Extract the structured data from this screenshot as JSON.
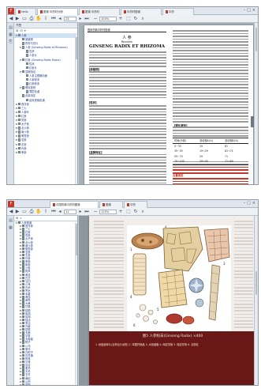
{
  "win1": {
    "tabs": [
      {
        "label": "Hello",
        "active": false
      },
      {
        "label": "图谱·中药材分册",
        "active": true
      },
      {
        "label": "图谱·中药材",
        "active": false
      },
      {
        "label": "中药材图谱",
        "active": false
      },
      {
        "label": "中药",
        "active": false
      }
    ],
    "page_field": "23",
    "zoom_field": "100%",
    "bookmarks_title": "书签",
    "bookmarks": [
      {
        "label": "人参",
        "level": 0,
        "expander": "minus"
      },
      {
        "label": "原植物",
        "level": 1,
        "expander": "none"
      },
      {
        "label": "药材与饮片",
        "level": 1,
        "expander": "none"
      },
      {
        "label": "人参 (Ginseng Radix et Rhizoma)",
        "level": 1,
        "expander": "minus"
      },
      {
        "label": "性状",
        "level": 2,
        "expander": "none"
      },
      {
        "label": "人参片",
        "level": 2,
        "expander": "none"
      },
      {
        "label": "红参 (Ginseng Radix Rubra)",
        "level": 1,
        "expander": "minus"
      },
      {
        "label": "性状",
        "level": 2,
        "expander": "none"
      },
      {
        "label": "红参片",
        "level": 2,
        "expander": "none"
      },
      {
        "label": "显微特征",
        "level": 1,
        "expander": "minus"
      },
      {
        "label": "人参主根横切面",
        "level": 2,
        "expander": "none"
      },
      {
        "label": "人参粉末",
        "level": 2,
        "expander": "none"
      },
      {
        "label": "红参粉末",
        "level": 2,
        "expander": "none"
      },
      {
        "label": "理化鉴别",
        "level": 1,
        "expander": "minus"
      },
      {
        "label": "薄层色谱",
        "level": 2,
        "expander": "none"
      },
      {
        "label": "含量测定",
        "level": 1,
        "expander": "none"
      },
      {
        "label": "高效液相色谱",
        "level": 2,
        "expander": "none"
      },
      {
        "label": "西洋参",
        "level": 0,
        "expander": "plus"
      },
      {
        "label": "三七",
        "level": 0,
        "expander": "plus"
      },
      {
        "label": "人参叶",
        "level": 0,
        "expander": "plus"
      },
      {
        "label": "红参",
        "level": 0,
        "expander": "plus"
      },
      {
        "label": "党参",
        "level": 0,
        "expander": "plus"
      },
      {
        "label": "太子参",
        "level": 0,
        "expander": "plus"
      },
      {
        "label": "北沙参",
        "level": 0,
        "expander": "plus"
      },
      {
        "label": "南沙参",
        "level": 0,
        "expander": "plus"
      },
      {
        "label": "明党参",
        "level": 0,
        "expander": "plus"
      },
      {
        "label": "苦参",
        "level": 0,
        "expander": "plus"
      },
      {
        "label": "玄参",
        "level": 0,
        "expander": "plus"
      },
      {
        "label": "丹参",
        "level": 0,
        "expander": "plus"
      },
      {
        "label": "拳参",
        "level": 0,
        "expander": "plus"
      }
    ],
    "page": {
      "header": "国家药典中药材图谱",
      "title_cn": "人 参",
      "title_latin": "Renshen",
      "title_en": "GINSENG RADIX ET RHIZOMA",
      "section_yuanzhiwu": "【原植物】",
      "section_xingzhuang": "【性状】",
      "section_xianwei": "【显微特征】",
      "section_lihua": "【理化鉴别】",
      "section_hanliang": "含量测定",
      "table_head": [
        "时间(分钟)",
        "流动相A(%)",
        "流动相B(%)"
      ],
      "table_rows": [
        [
          "0~35",
          "19",
          "81"
        ],
        [
          "35~55",
          "19→29",
          "81→71"
        ],
        [
          "55~70",
          "29",
          "71"
        ],
        [
          "70~100",
          "29→40",
          "71→60"
        ]
      ]
    }
  },
  "win2": {
    "tabs": [
      {
        "label": "中国药典中药材图谱",
        "active": true
      },
      {
        "label": "图谱",
        "active": false
      },
      {
        "label": "中药",
        "active": false
      }
    ],
    "page_field": "11",
    "zoom_field": "125%",
    "tree_items": [
      "人参图谱",
      "西洋参",
      "三七",
      "红参",
      "党参",
      "太子参",
      "北沙参",
      "南沙参",
      "明党参",
      "苦参",
      "玄参",
      "丹参",
      "拳参",
      "紫参",
      "沙参",
      "防风",
      "黄芪",
      "白芷",
      "当归",
      "川芎",
      "白术",
      "苍术",
      "木香",
      "黄连",
      "黄芩",
      "大黄",
      "甘草",
      "桔梗",
      "柴胡",
      "前胡",
      "独活",
      "羌活",
      "升麻",
      "葛根",
      "天麻",
      "半夏",
      "天南星",
      "附子",
      "川乌",
      "草乌",
      "白附子",
      "石菖蒲",
      "知母",
      "贝母",
      "百合",
      "麦冬",
      "天冬",
      "玉竹",
      "黄精",
      "山药",
      "茯苓",
      "猪苓"
    ],
    "caption": "图5 人参粉末(Ginseng Radix) ×400",
    "legend": "1. 树脂道碎片(含黄色分泌物)  2. 草酸钙簇晶  3. 木栓细胞  4. 网纹导管  5. 梯纹导管  6. 淀粉粒"
  }
}
